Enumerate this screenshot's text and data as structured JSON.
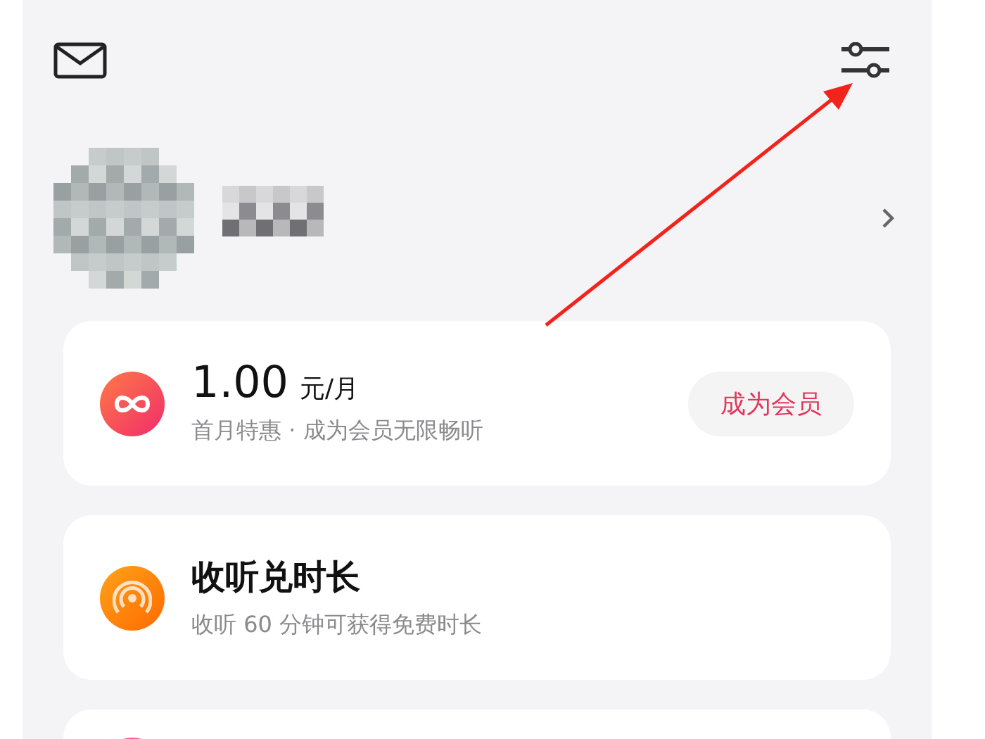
{
  "membership": {
    "price": "1.00",
    "unit": "元/月",
    "subtitle": "首月特惠 · 成为会员无限畅听",
    "button": "成为会员"
  },
  "listen_reward": {
    "title": "收听兑时长",
    "subtitle": "收听 60 分钟可获得免费时长"
  }
}
